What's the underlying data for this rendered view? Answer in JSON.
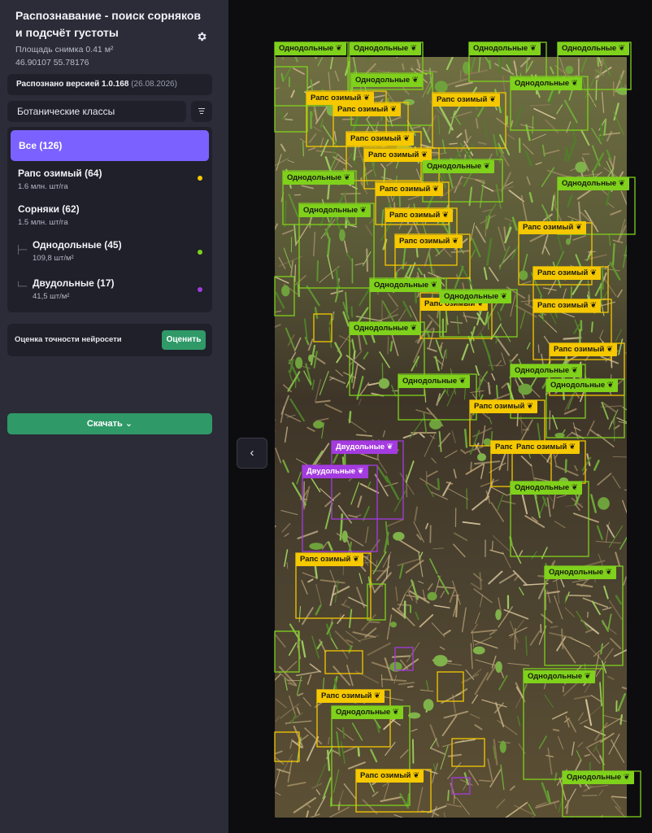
{
  "header": {
    "title": "Распознавание - поиск сорняков и подсчёт густоты",
    "area": "Площадь снимка 0.41 м²",
    "coords": "46.90107 55.78176"
  },
  "version": {
    "label": "Распознано версией 1.0.168",
    "date": "(26.08.2026)"
  },
  "classes_select": {
    "value": "Ботанические классы"
  },
  "classes": {
    "all": "Все (126)",
    "rape": {
      "name": "Рапс озимый (64)",
      "density": "1.6 млн. шт/га",
      "color": "#f5c800"
    },
    "weeds": {
      "name": "Сорняки (62)",
      "density": "1.5 млн. шт/га"
    },
    "mono": {
      "name": "Однодольные (45)",
      "density": "109,8 шт/м²",
      "color": "#7fd11b"
    },
    "dico": {
      "name": "Двудольные (17)",
      "density": "41,5 шт/м²",
      "color": "#a43be0"
    }
  },
  "accuracy": {
    "label": "Оценка точности нейросети",
    "button": "Оценить"
  },
  "download": {
    "label": "Скачать ⌄"
  },
  "nav": {
    "back_icon": "chevron-left-icon"
  },
  "detections": {
    "mono_label": "Однодольные",
    "rape_label": "Рапс озимый",
    "dico_label": "Двудольные",
    "leaf_icon": "leaf-icon",
    "colors": {
      "mono": "#7fd11b",
      "rape": "#f5c800",
      "dico": "#a43be0"
    }
  }
}
